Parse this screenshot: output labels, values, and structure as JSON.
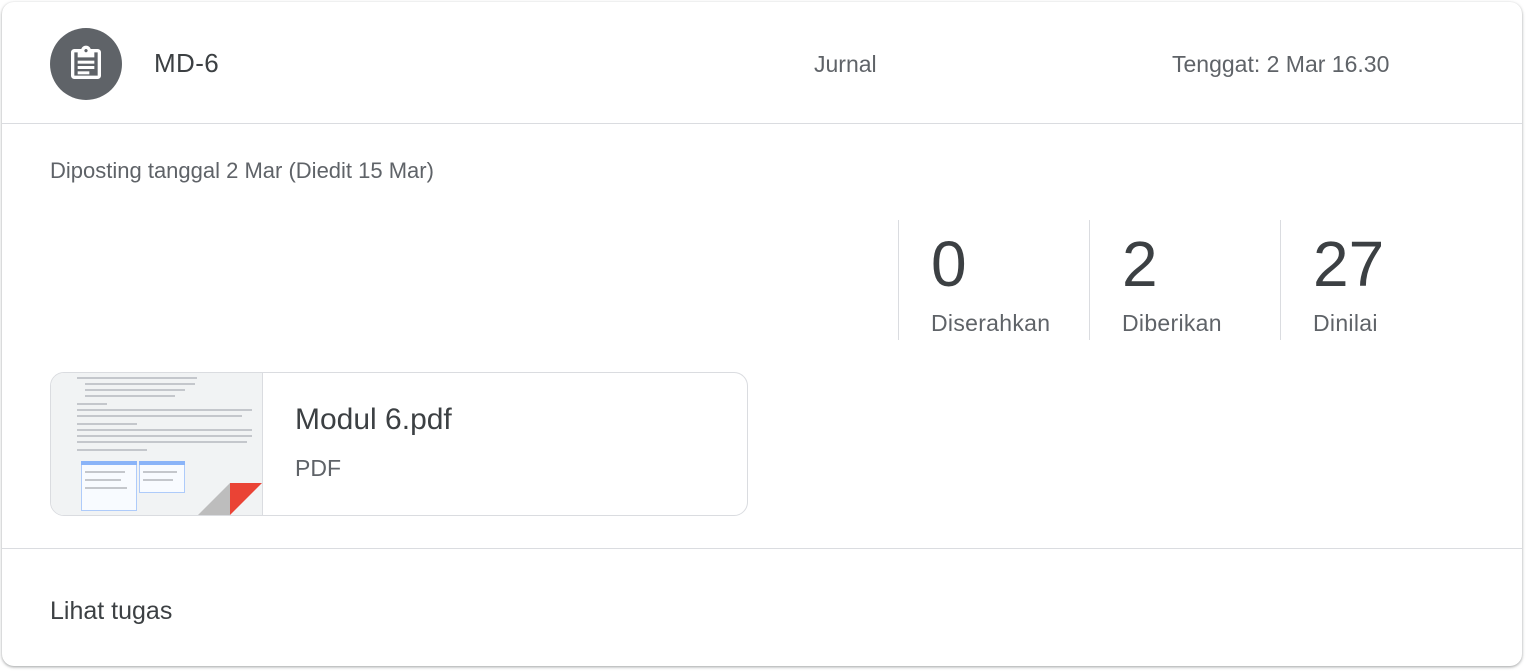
{
  "assignment": {
    "title": "MD-6",
    "topic": "Jurnal",
    "due": "Tenggat: 2 Mar 16.30",
    "posted": "Diposting tanggal 2 Mar (Diedit 15 Mar)",
    "icon": "assignment-icon"
  },
  "stats": [
    {
      "value": "0",
      "label": "Diserahkan"
    },
    {
      "value": "2",
      "label": "Diberikan"
    },
    {
      "value": "27",
      "label": "Dinilai"
    }
  ],
  "attachment": {
    "name": "Modul 6.pdf",
    "type": "PDF",
    "icon": "pdf-thumbnail"
  },
  "footer": {
    "link_label": "Lihat tugas"
  },
  "colors": {
    "icon_bg": "#5f6368",
    "pdf_red": "#ea4335",
    "divider": "#dadce0"
  }
}
